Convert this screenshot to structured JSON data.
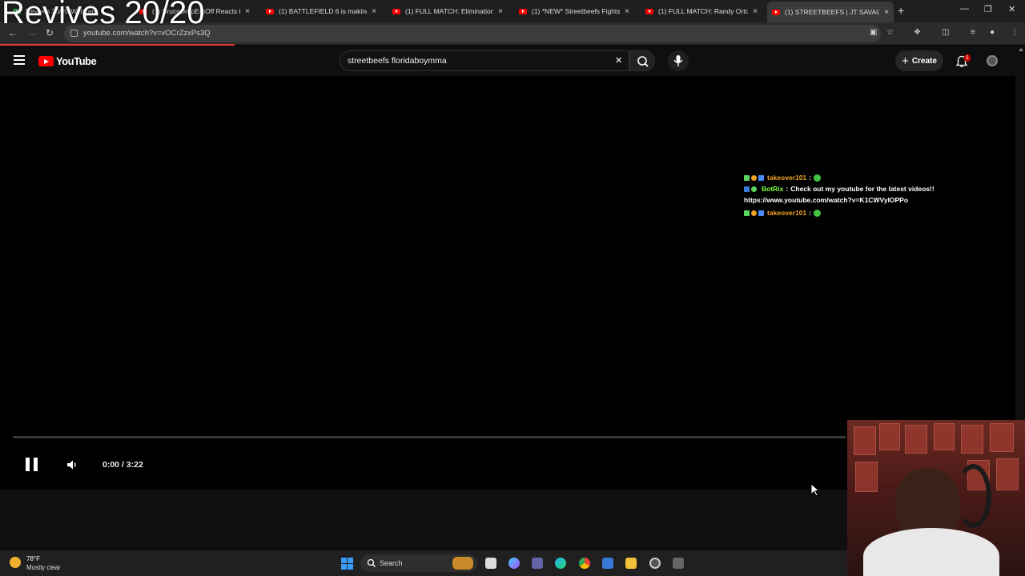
{
  "overlay": {
    "text": "Revives 20/20"
  },
  "browser": {
    "tabs": [
      {
        "title": "Revives 20/20 Webcam",
        "active": false
      },
      {
        "title": "(1) BruceDropEmOff Reacts to I",
        "active": false
      },
      {
        "title": "(1) BATTLEFIELD 6 is making m",
        "active": false
      },
      {
        "title": "(1) FULL MATCH: Elimination Ch",
        "active": false
      },
      {
        "title": "(1) *NEW* Streetbeefs Fights To",
        "active": false
      },
      {
        "title": "(1) FULL MATCH: Randy Orton v",
        "active": false
      },
      {
        "title": "(1) STREETBEEFS | JT SAVAGE vs",
        "active": true
      }
    ],
    "new_tab": "+",
    "url": "youtube.com/watch?v=vOCrZzxPs3Q",
    "tab_close": "×"
  },
  "youtube": {
    "logo_text": "YouTube",
    "search_value": "streetbeefs floridaboymma",
    "search_clear": "×",
    "create_label": "Create",
    "notification_count": "1"
  },
  "chat": {
    "messages": [
      {
        "user": "takeover101",
        "sep": ":",
        "text": ""
      },
      {
        "user": "BotRix",
        "sep": ":",
        "text": "Check out my youtube for the latest videos!!",
        "text2": "https://www.youtube.com/watch?v=K1CWVyIOPPo"
      },
      {
        "user": "takeover101",
        "sep": ":",
        "text": ""
      }
    ]
  },
  "player": {
    "time": "0:00 / 3:22",
    "progress": 0
  },
  "taskbar": {
    "weather_temp": "78°F",
    "weather_desc": "Mostly clear",
    "search_label": "Search"
  },
  "colors": {
    "yt_red": "#ff0000",
    "page_bg": "#0f0f0f",
    "chat_user_orange": "#f0a020",
    "chat_user_green": "#7dff40"
  }
}
